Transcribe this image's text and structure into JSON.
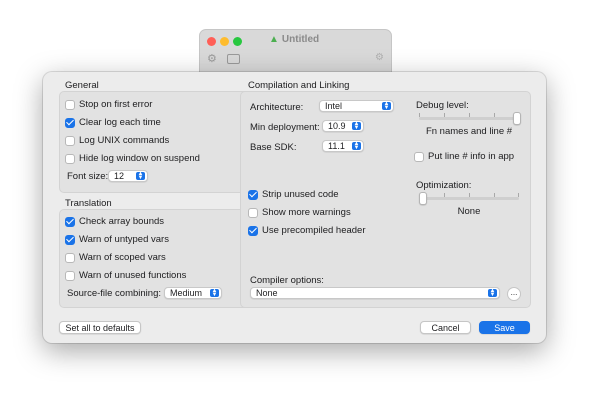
{
  "background_window": {
    "title": "Untitled",
    "colors": {
      "close": "#ff5f57",
      "minimize": "#febc2e",
      "zoom": "#28c840"
    }
  },
  "general": {
    "title": "General",
    "options": [
      {
        "label": "Stop on first error",
        "checked": false
      },
      {
        "label": "Clear log each time",
        "checked": true
      },
      {
        "label": "Log UNIX commands",
        "checked": false
      },
      {
        "label": "Hide log window on suspend",
        "checked": false
      }
    ],
    "font_size_label": "Font size:",
    "font_size_value": "12"
  },
  "translation": {
    "title": "Translation",
    "options": [
      {
        "label": "Check array bounds",
        "checked": true
      },
      {
        "label": "Warn of untyped vars",
        "checked": true
      },
      {
        "label": "Warn of scoped vars",
        "checked": false
      },
      {
        "label": "Warn of unused functions",
        "checked": false
      }
    ],
    "combining_label": "Source-file combining:",
    "combining_value": "Medium"
  },
  "compilation": {
    "title": "Compilation and Linking",
    "architecture_label": "Architecture:",
    "architecture_value": "Intel",
    "min_deployment_label": "Min deployment:",
    "min_deployment_value": "10.9",
    "base_sdk_label": "Base SDK:",
    "base_sdk_value": "11.1",
    "debug_level_label": "Debug level:",
    "debug_level_value": "Fn names and line #",
    "debug_level_position": 1.0,
    "line_info_label": "Put line # info in app",
    "line_info_checked": false,
    "options": [
      {
        "label": "Strip unused code",
        "checked": true
      },
      {
        "label": "Show more warnings",
        "checked": false
      },
      {
        "label": "Use precompiled header",
        "checked": true
      }
    ],
    "optimization_label": "Optimization:",
    "optimization_value": "None",
    "optimization_position": 0.0,
    "compiler_options_label": "Compiler options:",
    "compiler_options_value": "None",
    "more_button": "..."
  },
  "footer": {
    "defaults_button": "Set all to defaults",
    "cancel_button": "Cancel",
    "save_button": "Save"
  },
  "accent_color": "#1a73e8"
}
